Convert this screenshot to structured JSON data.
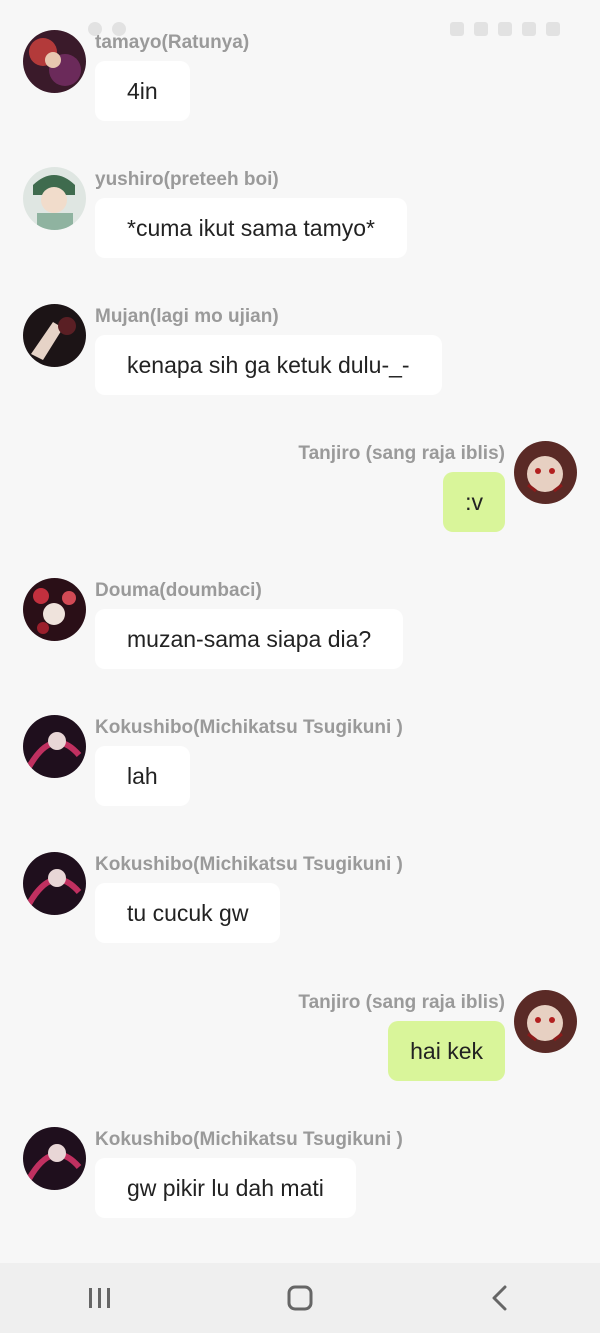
{
  "messages": [
    {
      "side": "left",
      "sender": "tamayo(Ratunya)",
      "text": "4in",
      "avatar": "avatar-tamayo"
    },
    {
      "side": "left",
      "sender": "yushiro(preteeh boi)",
      "text": "*cuma ikut sama tamyo*",
      "avatar": "avatar-yushiro"
    },
    {
      "side": "left",
      "sender": "Mujan(lagi mo ujian)",
      "text": "kenapa sih ga ketuk dulu-_-",
      "avatar": "avatar-mujan"
    },
    {
      "side": "right",
      "sender": "Tanjiro (sang raja iblis)",
      "text": ":v",
      "avatar": "avatar-tanjiro"
    },
    {
      "side": "left",
      "sender": "Douma(doumbaci)",
      "text": "muzan-sama siapa dia?",
      "avatar": "avatar-douma"
    },
    {
      "side": "left",
      "sender": "Kokushibo(Michikatsu Tsugikuni )",
      "text": "lah",
      "avatar": "avatar-kokushibo"
    },
    {
      "side": "left",
      "sender": "Kokushibo(Michikatsu Tsugikuni )",
      "text": "tu cucuk gw",
      "avatar": "avatar-kokushibo"
    },
    {
      "side": "right",
      "sender": "Tanjiro (sang raja iblis)",
      "text": "hai kek",
      "avatar": "avatar-tanjiro"
    },
    {
      "side": "left",
      "sender": "Kokushibo(Michikatsu Tsugikuni )",
      "text": "gw pikir lu dah mati",
      "avatar": "avatar-kokushibo"
    }
  ],
  "colors": {
    "background": "#f7f7f7",
    "bubble_other": "#ffffff",
    "bubble_mine": "#d9f59a",
    "sender_name": "#9a9a9a",
    "message_text": "#222222",
    "navbar": "#efefef"
  },
  "navbar": {
    "recent_icon": "recent-apps-icon",
    "home_icon": "home-icon",
    "back_icon": "back-icon"
  }
}
